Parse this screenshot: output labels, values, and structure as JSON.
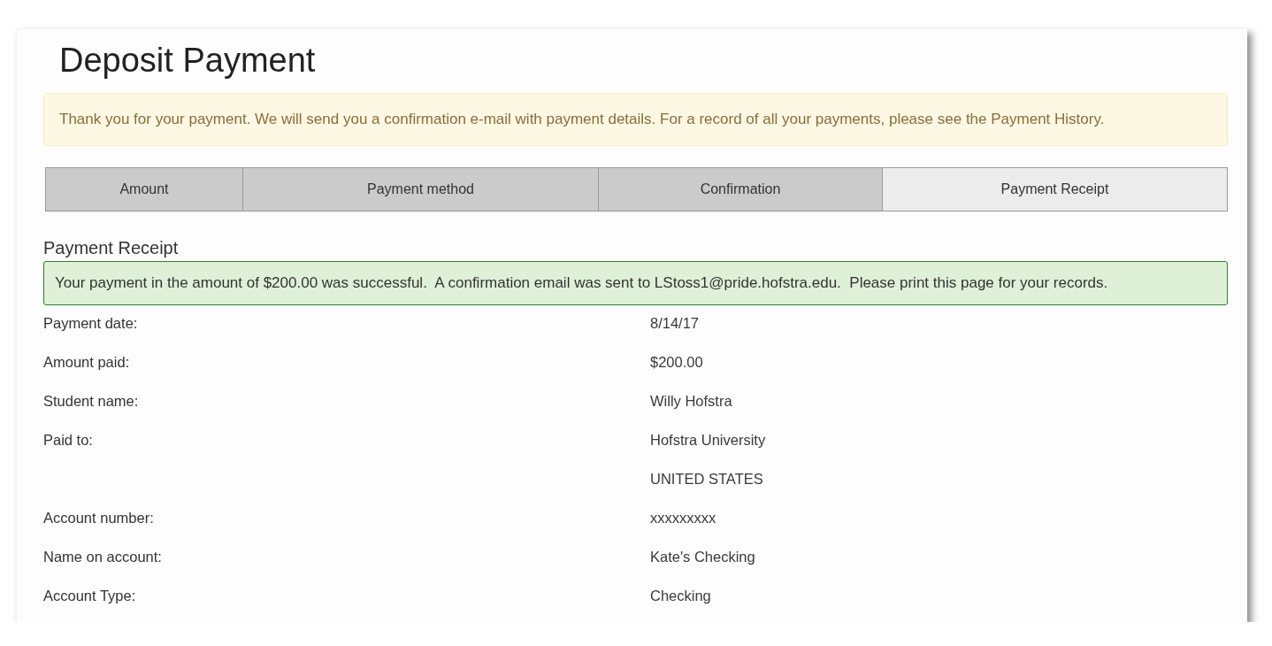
{
  "page": {
    "title": "Deposit Payment"
  },
  "notice": {
    "text": "Thank you for your payment. We will send you a confirmation e-mail with payment details. For a record of all your payments, please see the Payment History."
  },
  "steps": [
    {
      "label": "Amount",
      "selected": false
    },
    {
      "label": "Payment method",
      "selected": false
    },
    {
      "label": "Confirmation",
      "selected": false
    },
    {
      "label": "Payment Receipt",
      "selected": true
    }
  ],
  "receipt": {
    "heading": "Payment Receipt",
    "success_message": "Your payment in the amount of $200.00 was successful.  A confirmation email was sent to LStoss1@pride.hofstra.edu.  Please print this page for your records.",
    "rows": [
      {
        "label": "Payment date:",
        "values": [
          "8/14/17"
        ]
      },
      {
        "label": "Amount paid:",
        "values": [
          "$200.00"
        ]
      },
      {
        "label": "Student name:",
        "values": [
          "Willy Hofstra"
        ]
      },
      {
        "label": "Paid to:",
        "values": [
          "Hofstra University",
          "UNITED STATES"
        ]
      },
      {
        "label": "Account number:",
        "values": [
          "xxxxxxxxx"
        ]
      },
      {
        "label": "Name on account:",
        "values": [
          "Kate's Checking"
        ]
      },
      {
        "label": "Account Type:",
        "values": [
          "Checking"
        ]
      }
    ]
  }
}
